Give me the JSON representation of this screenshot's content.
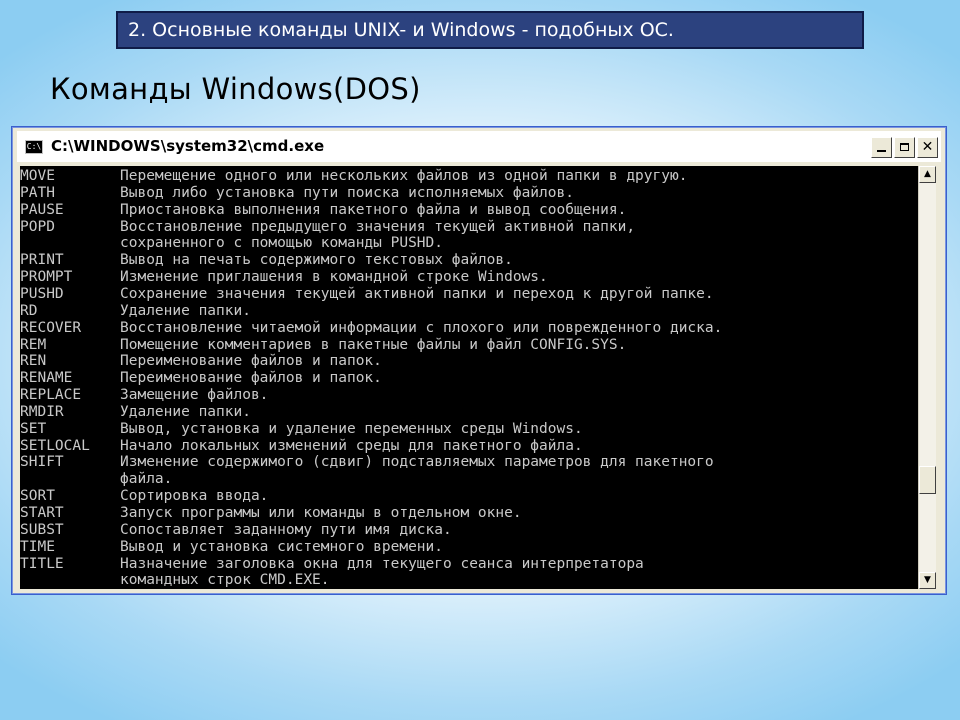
{
  "slide": {
    "header": "2. Основные команды UNIX- и Windows - подобных ОС.",
    "title": "Команды Windows(DOS)"
  },
  "window": {
    "title": "C:\\WINDOWS\\system32\\cmd.exe",
    "icon_label": "C:\\",
    "buttons": [
      "minimize-icon",
      "maximize-icon",
      "close-icon"
    ],
    "close_label": "✕"
  },
  "scrollbar": {
    "up_arrow": "▲",
    "down_arrow": "▼"
  },
  "console": {
    "text_color": "#c9c9c9",
    "background": "#000000",
    "rows": [
      {
        "cmd": "MOVE",
        "desc": "Перемещение одного или нескольких файлов из одной папки в другую."
      },
      {
        "cmd": "PATH",
        "desc": "Вывод либо установка пути поиска исполняемых файлов."
      },
      {
        "cmd": "PAUSE",
        "desc": "Приостановка выполнения пакетного файла и вывод сообщения."
      },
      {
        "cmd": "POPD",
        "desc": "Восстановление предыдущего значения текущей активной папки,"
      },
      {
        "cmd": "",
        "desc": "сохраненного с помощью команды PUSHD."
      },
      {
        "cmd": "PRINT",
        "desc": "Вывод на печать содержимого текстовых файлов."
      },
      {
        "cmd": "PROMPT",
        "desc": "Изменение приглашения в командной строке Windows."
      },
      {
        "cmd": "PUSHD",
        "desc": "Сохранение значения текущей активной папки и переход к другой папке."
      },
      {
        "cmd": "RD",
        "desc": "Удаление папки."
      },
      {
        "cmd": "RECOVER",
        "desc": "Восстановление читаемой информации с плохого или поврежденного диска."
      },
      {
        "cmd": "REM",
        "desc": "Помещение комментариев в пакетные файлы и файл CONFIG.SYS."
      },
      {
        "cmd": "REN",
        "desc": "Переименование файлов и папок."
      },
      {
        "cmd": "RENAME",
        "desc": "Переименование файлов и папок."
      },
      {
        "cmd": "REPLACE",
        "desc": "Замещение файлов."
      },
      {
        "cmd": "RMDIR",
        "desc": "Удаление папки."
      },
      {
        "cmd": "SET",
        "desc": "Вывод, установка и удаление переменных среды Windows."
      },
      {
        "cmd": "SETLOCAL",
        "desc": "Начало локальных изменений среды для пакетного файла."
      },
      {
        "cmd": "SHIFT",
        "desc": "Изменение содержимого (сдвиг) подставляемых параметров для пакетного"
      },
      {
        "cmd": "",
        "desc": "файла."
      },
      {
        "cmd": "SORT",
        "desc": "Сортировка ввода."
      },
      {
        "cmd": "START",
        "desc": "Запуск программы или команды в отдельном окне."
      },
      {
        "cmd": "SUBST",
        "desc": "Сопоставляет заданному пути имя диска."
      },
      {
        "cmd": "TIME",
        "desc": "Вывод и установка системного времени."
      },
      {
        "cmd": "TITLE",
        "desc": "Назначение заголовка окна для текущего сеанса интерпретатора"
      },
      {
        "cmd": "",
        "desc": "командных строк CMD.EXE."
      }
    ]
  }
}
